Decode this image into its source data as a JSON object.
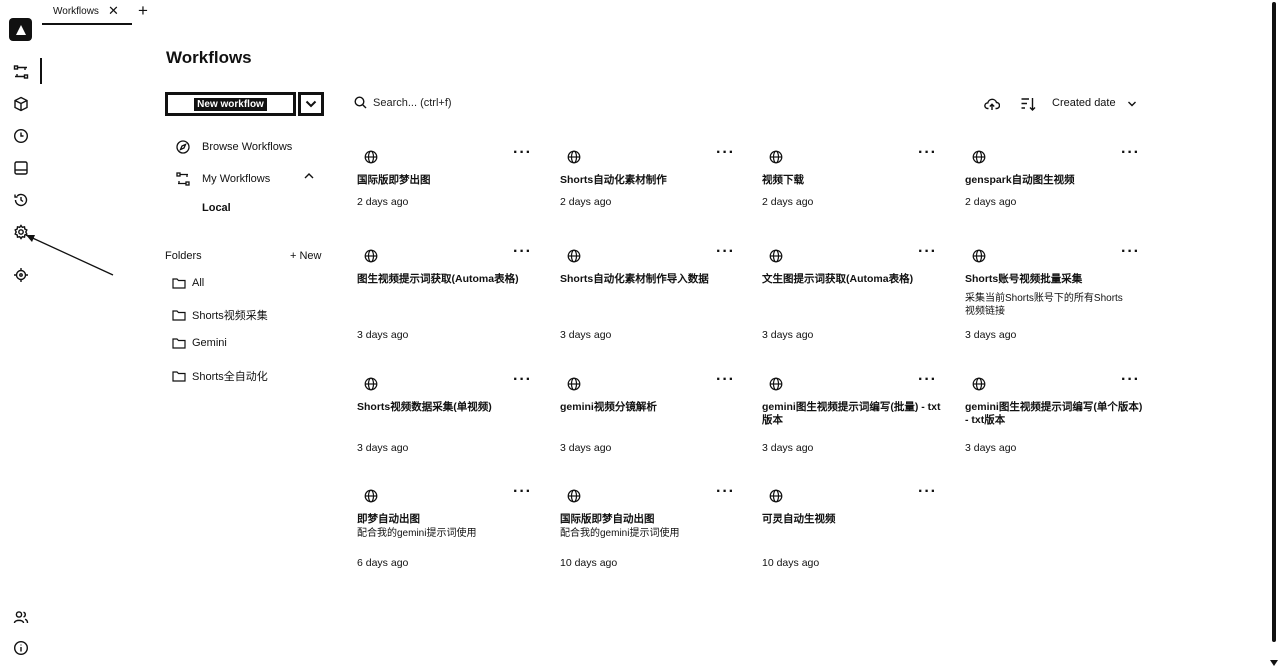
{
  "tab": {
    "label": "Workflows",
    "close": "✕",
    "add": "+"
  },
  "page_title": "Workflows",
  "new_workflow_label": "New workflow",
  "nav": {
    "browse": "Browse Workflows",
    "my_workflows": "My Workflows",
    "local": "Local"
  },
  "folders": {
    "label": "Folders",
    "new_label": "+ New",
    "items": [
      "All",
      "Shorts视频采集",
      "Gemini",
      "Shorts全自动化"
    ]
  },
  "search": {
    "placeholder": "Search... (ctrl+f)"
  },
  "sort_label": "Created date",
  "workflows": [
    {
      "name": "国际版即梦出图",
      "desc": "",
      "time": "2 days ago"
    },
    {
      "name": "Shorts自动化素材制作",
      "desc": "",
      "time": "2 days ago"
    },
    {
      "name": "视频下载",
      "desc": "",
      "time": "2 days ago"
    },
    {
      "name": "genspark自动图生视频",
      "desc": "",
      "time": "2 days ago"
    },
    {
      "name": "图生视频提示词获取(Automa表格)",
      "desc": "",
      "time": "3 days ago"
    },
    {
      "name": "Shorts自动化素材制作导入数据",
      "desc": "",
      "time": "3 days ago"
    },
    {
      "name": "文生图提示词获取(Automa表格)",
      "desc": "",
      "time": "3 days ago"
    },
    {
      "name": "Shorts账号视频批量采集",
      "desc": "采集当前Shorts账号下的所有Shorts视频链接",
      "time": "3 days ago"
    },
    {
      "name": "Shorts视频数据采集(单视频)",
      "desc": "",
      "time": "3 days ago"
    },
    {
      "name": "gemini视频分镜解析",
      "desc": "",
      "time": "3 days ago"
    },
    {
      "name": "gemini图生视频提示词编写(批量) - txt版本",
      "desc": "",
      "time": "3 days ago"
    },
    {
      "name": "gemini图生视频提示词编写(单个版本) - txt版本",
      "desc": "",
      "time": "3 days ago"
    },
    {
      "name": "即梦自动出图",
      "desc": "配合我的gemini提示词使用",
      "time": "6 days ago"
    },
    {
      "name": "国际版即梦自动出图",
      "desc": "配合我的gemini提示词使用",
      "time": "10 days ago"
    },
    {
      "name": "可灵自动生视频",
      "desc": "",
      "time": "10 days ago"
    }
  ]
}
